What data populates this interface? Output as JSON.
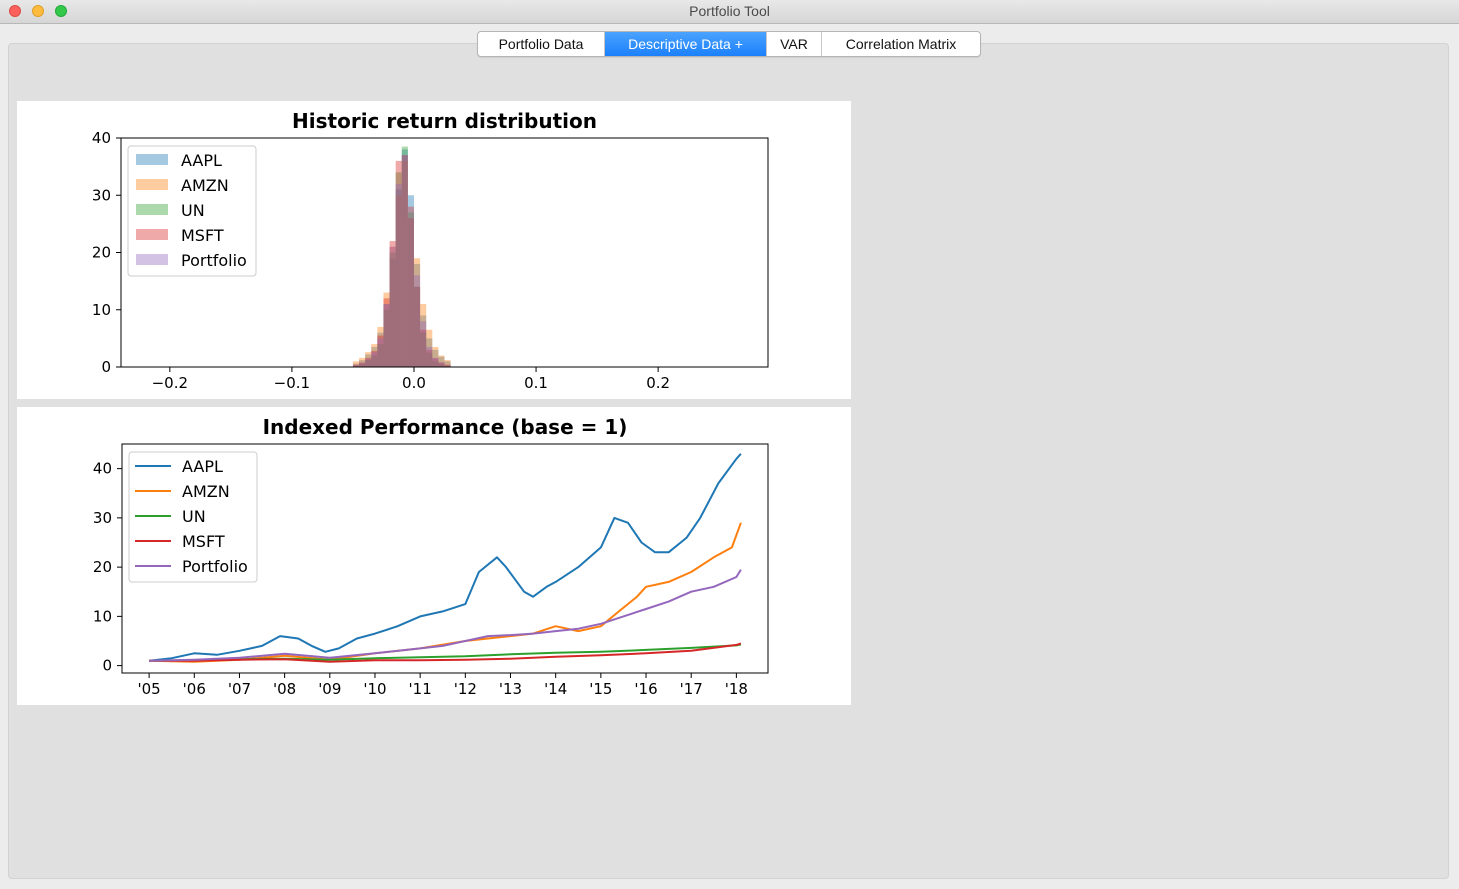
{
  "window": {
    "title": "Portfolio Tool"
  },
  "tabs": [
    {
      "label": "Portfolio Data"
    },
    {
      "label": "Descriptive Data +"
    },
    {
      "label": "VAR"
    },
    {
      "label": "Correlation Matrix"
    }
  ],
  "chart_data": [
    {
      "type": "histogram",
      "title": "Historic return distribution",
      "xlabel": "",
      "ylabel": "",
      "xlim": [
        -0.24,
        0.29
      ],
      "ylim": [
        0,
        40
      ],
      "x_ticks": [
        "−0.2",
        "−0.1",
        "0.0",
        "0.1",
        "0.2"
      ],
      "x_tick_values": [
        -0.2,
        -0.1,
        0.0,
        0.1,
        0.2
      ],
      "y_ticks": [
        "0",
        "10",
        "20",
        "30",
        "40"
      ],
      "y_tick_values": [
        0,
        10,
        20,
        30,
        40
      ],
      "legend_position": "upper-left",
      "bins": {
        "start": -0.05,
        "width": 0.005
      },
      "series": [
        {
          "name": "AAPL",
          "color": "#1f77b4",
          "values": [
            0.6,
            1.2,
            2.2,
            3.5,
            6,
            11,
            19,
            31,
            38,
            30,
            18,
            9,
            5,
            3,
            1.8,
            1
          ]
        },
        {
          "name": "AMZN",
          "color": "#ff7f0e",
          "values": [
            1,
            1.6,
            2.6,
            4,
            7,
            13,
            21,
            30,
            36,
            28,
            19,
            11,
            6.5,
            3.5,
            2,
            1.2
          ]
        },
        {
          "name": "UN",
          "color": "#2ca02c",
          "values": [
            0.2,
            0.5,
            1.2,
            2,
            4,
            10,
            20,
            34,
            38.5,
            27,
            14,
            6,
            2.5,
            1,
            0.5,
            0.2
          ]
        },
        {
          "name": "MSFT",
          "color": "#d62728",
          "values": [
            0.4,
            0.8,
            1.6,
            2.8,
            5.5,
            12,
            22,
            36,
            37,
            26,
            14,
            6.5,
            3,
            1.5,
            0.8,
            0.4
          ]
        },
        {
          "name": "Portfolio",
          "color": "#9467bd",
          "values": [
            0.3,
            0.7,
            1.4,
            2.6,
            5,
            11,
            21,
            32,
            37,
            28,
            16,
            8,
            3.5,
            1.6,
            0.8,
            0.3
          ]
        }
      ]
    },
    {
      "type": "line",
      "title": "Indexed Performance (base = 1)",
      "xlabel": "",
      "ylabel": "",
      "xlim": [
        2004.4,
        2018.7
      ],
      "ylim": [
        -1.5,
        45
      ],
      "x_ticks": [
        "'05",
        "'06",
        "'07",
        "'08",
        "'09",
        "'10",
        "'11",
        "'12",
        "'13",
        "'14",
        "'15",
        "'16",
        "'17",
        "'18"
      ],
      "x_tick_values": [
        2005,
        2006,
        2007,
        2008,
        2009,
        2010,
        2011,
        2012,
        2013,
        2014,
        2015,
        2016,
        2017,
        2018
      ],
      "y_ticks": [
        "0",
        "10",
        "20",
        "30",
        "40"
      ],
      "y_tick_values": [
        0,
        10,
        20,
        30,
        40
      ],
      "legend_position": "upper-left",
      "series": [
        {
          "name": "AAPL",
          "color": "#1f77b4",
          "x": [
            2005,
            2005.5,
            2006,
            2006.5,
            2007,
            2007.5,
            2007.9,
            2008.3,
            2008.6,
            2008.9,
            2009.2,
            2009.6,
            2010,
            2010.5,
            2011,
            2011.5,
            2012,
            2012.3,
            2012.7,
            2012.9,
            2013.3,
            2013.5,
            2013.8,
            2014,
            2014.5,
            2015,
            2015.3,
            2015.6,
            2015.9,
            2016.2,
            2016.5,
            2016.9,
            2017.2,
            2017.6,
            2018,
            2018.1
          ],
          "y": [
            1,
            1.5,
            2.5,
            2.2,
            3,
            4,
            6,
            5.5,
            4,
            2.8,
            3.5,
            5.5,
            6.5,
            8,
            10,
            11,
            12.5,
            19,
            22,
            20,
            15,
            14,
            16,
            17,
            20,
            24,
            30,
            29,
            25,
            23,
            23,
            26,
            30,
            37,
            42,
            43
          ]
        },
        {
          "name": "AMZN",
          "color": "#ff7f0e",
          "x": [
            2005,
            2006,
            2007,
            2008,
            2009,
            2010,
            2011,
            2012,
            2012.5,
            2013,
            2013.5,
            2014,
            2014.5,
            2015,
            2015.4,
            2015.8,
            2016,
            2016.5,
            2017,
            2017.5,
            2017.9,
            2018.1
          ],
          "y": [
            1,
            0.8,
            1.2,
            2,
            1.2,
            2.5,
            3.5,
            5,
            5.5,
            6,
            6.5,
            8,
            7,
            8,
            11,
            14,
            16,
            17,
            19,
            22,
            24,
            29
          ]
        },
        {
          "name": "UN",
          "color": "#2ca02c",
          "x": [
            2005,
            2006,
            2007,
            2008,
            2009,
            2010,
            2011,
            2012,
            2013,
            2014,
            2015,
            2016,
            2017,
            2018,
            2018.1
          ],
          "y": [
            1,
            1.1,
            1.3,
            1.4,
            1.2,
            1.5,
            1.7,
            1.9,
            2.3,
            2.6,
            2.8,
            3.2,
            3.6,
            4.1,
            4.3
          ]
        },
        {
          "name": "MSFT",
          "color": "#d62728",
          "x": [
            2005,
            2006,
            2007,
            2008,
            2009,
            2010,
            2011,
            2012,
            2013,
            2014,
            2015,
            2016,
            2017,
            2018,
            2018.1
          ],
          "y": [
            1,
            1,
            1.2,
            1.3,
            0.8,
            1.1,
            1.1,
            1.2,
            1.4,
            1.8,
            2.1,
            2.5,
            3,
            4.2,
            4.5
          ]
        },
        {
          "name": "Portfolio",
          "color": "#9467bd",
          "x": [
            2005,
            2006,
            2007,
            2008,
            2009,
            2010,
            2011,
            2011.5,
            2012,
            2012.5,
            2013,
            2013.5,
            2014,
            2014.5,
            2015,
            2015.5,
            2016,
            2016.5,
            2017,
            2017.5,
            2018,
            2018.1
          ],
          "y": [
            1,
            1.2,
            1.6,
            2.4,
            1.6,
            2.5,
            3.5,
            4,
            5,
            6,
            6.2,
            6.5,
            7,
            7.5,
            8.5,
            10,
            11.5,
            13,
            15,
            16,
            18,
            19.5
          ]
        }
      ]
    }
  ]
}
